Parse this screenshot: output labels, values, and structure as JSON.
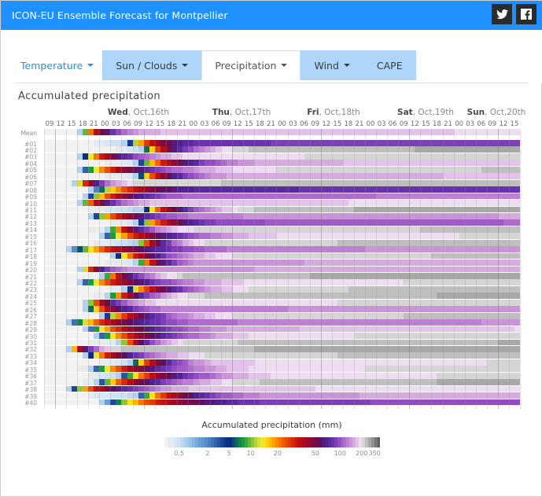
{
  "header": {
    "title": "ICON-EU Ensemble Forecast for Montpellier",
    "bg_color": "#1e90ff",
    "social": [
      {
        "name": "twitter-icon",
        "label": "Twitter"
      },
      {
        "name": "facebook-icon",
        "label": "Facebook"
      }
    ]
  },
  "tabs": [
    {
      "label": "Temperature",
      "caret": true,
      "style": "plain",
      "active": false
    },
    {
      "label": "Sun / Clouds",
      "caret": true,
      "style": "filled",
      "active": false
    },
    {
      "label": "Precipitation",
      "caret": true,
      "style": "filled",
      "active": true
    },
    {
      "label": "Wind",
      "caret": true,
      "style": "filled",
      "active": false
    },
    {
      "label": "CAPE",
      "caret": false,
      "style": "filled",
      "active": false
    }
  ],
  "chart_data": {
    "type": "heatmap",
    "title": "Accumulated precipitation",
    "xlabel": "",
    "ylabel": "",
    "unit": "mm",
    "legend_title": "Accumulated precipitation (mm)",
    "legend_position": "bottom",
    "grid": true,
    "day_labels": [
      {
        "weekday": "Wed",
        "date": "Oct,16th"
      },
      {
        "weekday": "Thu",
        "date": "Oct,17th"
      },
      {
        "weekday": "Fri",
        "date": "Oct,18th"
      },
      {
        "weekday": "Sat",
        "date": "Oct,19th"
      },
      {
        "weekday": "Sun",
        "date": "Oct,20th"
      }
    ],
    "hour_ticks": [
      "09",
      "12",
      "15",
      "18",
      "21",
      "00",
      "03",
      "06",
      "09",
      "12",
      "15",
      "18",
      "21",
      "00",
      "03",
      "06",
      "09",
      "12",
      "15",
      "18",
      "21",
      "00",
      "03",
      "06",
      "09",
      "12",
      "15",
      "18",
      "21",
      "00",
      "03",
      "06",
      "09",
      "12",
      "15",
      "18",
      "21",
      "00",
      "03",
      "06",
      "09",
      "12",
      "15"
    ],
    "row_labels": [
      "Mean",
      "#01",
      "#02",
      "#03",
      "#04",
      "#05",
      "#06",
      "#07",
      "#08",
      "#09",
      "#10",
      "#11",
      "#12",
      "#13",
      "#14",
      "#15",
      "#16",
      "#17",
      "#18",
      "#19",
      "#20",
      "#21",
      "#22",
      "#23",
      "#24",
      "#25",
      "#26",
      "#27",
      "#28",
      "#29",
      "#30",
      "#31",
      "#32",
      "#33",
      "#34",
      "#35",
      "#36",
      "#37",
      "#38",
      "#39",
      "#40"
    ],
    "colorbar": {
      "tick_labels": [
        "0.5",
        "2",
        "5",
        "10",
        "20",
        "50",
        "100",
        "200",
        "350"
      ],
      "tick_values": [
        0.5,
        2,
        5,
        10,
        20,
        50,
        100,
        200,
        350
      ],
      "tick_positions_pct": [
        6.8,
        20.0,
        30.0,
        40.0,
        52.5,
        70.0,
        81.5,
        91.5,
        97.5
      ],
      "colors": [
        "#f2f2f2",
        "#eaeaea",
        "#e2eaf2",
        "#d8e6f5",
        "#cfe1f4",
        "#c2d9f1",
        "#b4d2ef",
        "#a6cbec",
        "#96c1e8",
        "#86b6e3",
        "#76abdd",
        "#6aa0d6",
        "#6296d0",
        "#5a8cc9",
        "#4f80c2",
        "#4271b9",
        "#3561ad",
        "#2a53a2",
        "#1f4598",
        "#16398d",
        "#0e3083",
        "#0b2f7e",
        "#0d4f6e",
        "#0f6a5a",
        "#10854a",
        "#1e9a3e",
        "#3aa83a",
        "#63b83a",
        "#8cc63a",
        "#b5d33a",
        "#d9de37",
        "#f2e52e",
        "#fbe01c",
        "#fdcf0d",
        "#fdb806",
        "#fca003",
        "#fa8a02",
        "#f67402",
        "#f15e02",
        "#e94c03",
        "#e03a05",
        "#d62908",
        "#cc1a0b",
        "#c00f10",
        "#b50c16",
        "#a90a1e",
        "#9a0a28",
        "#8b0b33",
        "#7c0c40",
        "#6d0d4c",
        "#5e1060",
        "#551a78",
        "#4e2290",
        "#5b2a9f",
        "#6a33ad",
        "#7c3fb8",
        "#8f4dc1",
        "#a15bc7",
        "#b06ccc",
        "#bd80d2",
        "#c995d8",
        "#d6abdf",
        "#e3c3e9",
        "#eedcf1",
        "#d5d5d5",
        "#bfbfbf",
        "#a8a8a8",
        "#8f8f8f",
        "#777777",
        "#5e5e5e"
      ]
    },
    "axis_range": {
      "x_start_hour": "09",
      "x_end_hour": "15",
      "columns": 86,
      "rows": 41
    },
    "notes": "41 horizontal strip rows (ensemble Mean + members #01..#40), each coloured by cumulative rainfall; values start near 0 (white/grey) on the left and grow monotonically to the right, reaching the 100-350+ mm (dark red / purple / violet) end of the scale by Sun Oct 20th."
  }
}
